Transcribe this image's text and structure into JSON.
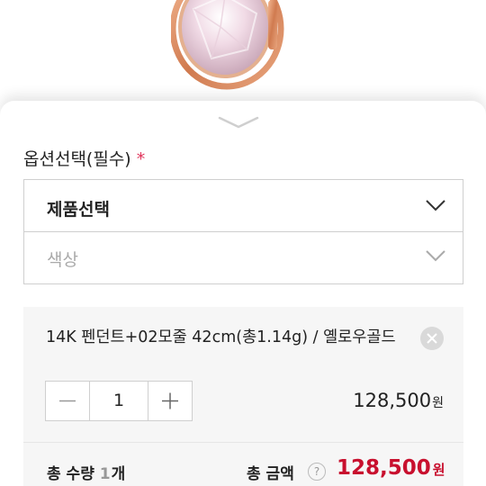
{
  "options": {
    "title": "옵션선택(필수)",
    "required_mark": "*",
    "product_select": {
      "value": "제품선택"
    },
    "color_select": {
      "placeholder": "색상"
    }
  },
  "selected_item": {
    "name": "14K 펜던트+02모줄 42cm(총1.14g) / 옐로우골드",
    "quantity": "1",
    "price": "128,500",
    "price_unit": "원"
  },
  "summary": {
    "quantity_label": "총 수량",
    "quantity_value": "1",
    "quantity_unit": "개",
    "amount_label": "총 금액",
    "help_symbol": "?",
    "amount_value": "128,500",
    "amount_unit": "원"
  },
  "colors": {
    "accent_price": "#c8102e",
    "required": "#e0335a",
    "rose_gold": "#d98a5e"
  }
}
